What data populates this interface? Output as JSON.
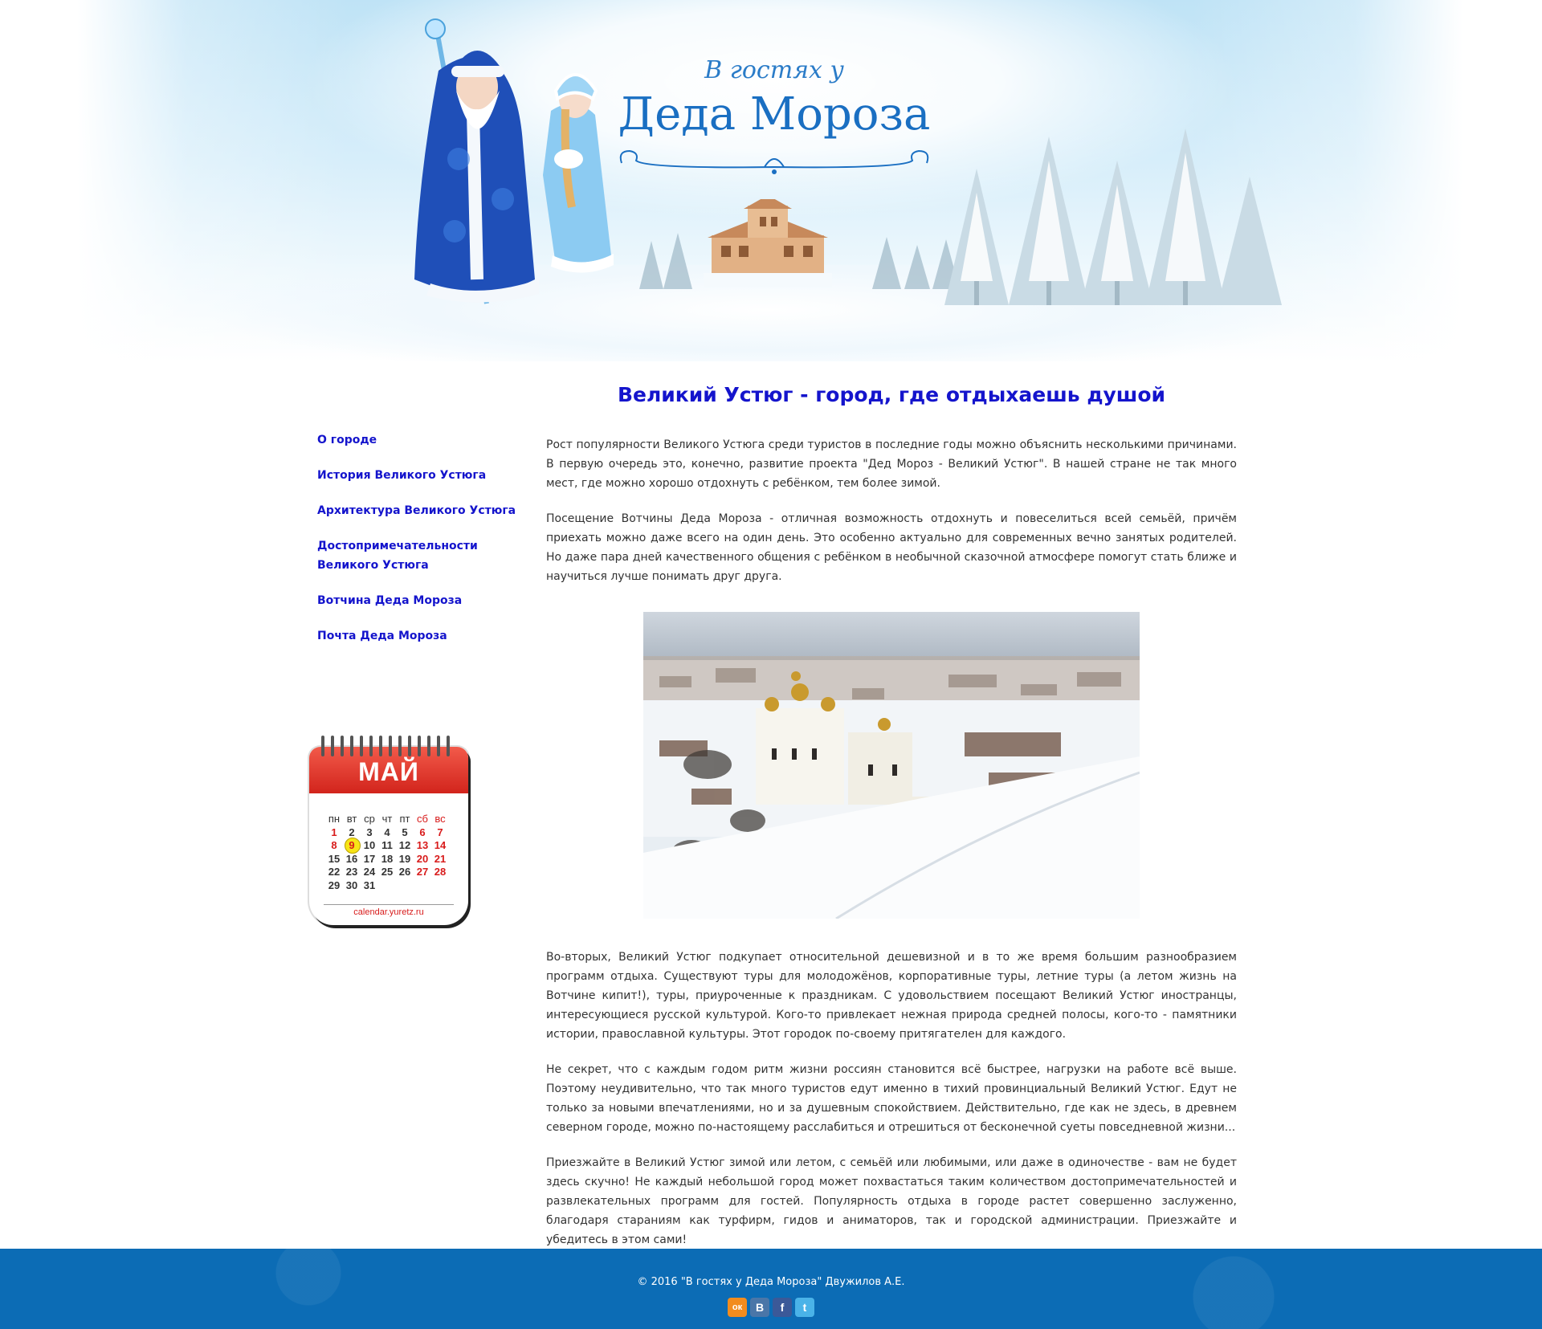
{
  "header": {
    "logo_small": "В гостях у",
    "logo_big": "Деда Мороза"
  },
  "nav": {
    "items": [
      "О городе",
      "История Великого Устюга",
      "Архитектура Великого Устюга",
      "Достопримечательности Великого Устюга",
      "Вотчина Деда Мороза",
      "Почта Деда Мороза"
    ]
  },
  "calendar": {
    "month": "МАЙ",
    "weekdays": [
      "пн",
      "вт",
      "ср",
      "чт",
      "пт",
      "сб",
      "вс"
    ],
    "weeks": [
      [
        "1",
        "2",
        "3",
        "4",
        "5",
        "6",
        "7"
      ],
      [
        "8",
        "9",
        "10",
        "11",
        "12",
        "13",
        "14"
      ],
      [
        "15",
        "16",
        "17",
        "18",
        "19",
        "20",
        "21"
      ],
      [
        "22",
        "23",
        "24",
        "25",
        "26",
        "27",
        "28"
      ],
      [
        "29",
        "30",
        "31",
        "",
        "",
        "",
        ""
      ]
    ],
    "holidays": [
      "1",
      "8",
      "9"
    ],
    "today": "9",
    "source": "calendar.yuretz.ru",
    "colors": {
      "header": "#d2241c",
      "weekend": "#d81b1b",
      "today": "#f7e417"
    }
  },
  "main": {
    "title": "Великий Устюг - город, где отдыхаешь душой",
    "paragraphs_top": [
      "Рост популярности Великого Устюга среди туристов в последние годы можно объяснить несколькими причинами. В первую очередь это, конечно, развитие проекта \"Дед Мороз - Великий Устюг\". В нашей стране не так много мест, где можно хорошо отдохнуть с ребёнком, тем более зимой.",
      "Посещение Вотчины Деда Мороза - отличная возможность отдохнуть и повеселиться всей семьёй, причём приехать можно даже всего на один день. Это особенно актуально для современных вечно занятых родителей. Но даже пара дней качественного общения с ребёнком в необычной сказочной атмосфере помогут стать ближе и научиться лучше понимать друг друга."
    ],
    "paragraphs_bottom": [
      "Во-вторых, Великий Устюг подкупает относительной дешевизной и в то же время большим разнообразием программ отдыха. Существуют туры для молодожёнов, корпоративные туры, летние туры (а летом жизнь на Вотчине кипит!), туры, приуроченные к праздникам. С удовольствием посещают Великий Устюг иностранцы, интересующиеся русской культурой. Кого-то привлекает нежная природа средней полосы, кого-то - памятники истории, православной культуры. Этот городок по-своему притягателен для каждого.",
      "Не секрет, что с каждым годом ритм жизни россиян становится всё быстрее, нагрузки на работе всё выше. Поэтому неудивительно, что так много туристов едут именно в тихий провинциальный Великий Устюг. Едут не только за новыми впечатлениями, но и за душевным спокойствием. Действительно, где как не здесь, в древнем северном городе, можно по-настоящему расслабиться и отрешиться от бесконечной суеты повседневной жизни...",
      "Приезжайте в Великий Устюг зимой или летом, с семьёй или любимыми, или даже в одиночестве - вам не будет здесь скучно! Не каждый небольшой город может похвастаться таким количеством достопримечательностей и развлекательных программ для гостей. Популярность отдыха в городе растет совершенно заслуженно, благодаря стараниям как турфирм, гидов и аниматоров, так и городской администрации. Приезжайте и убедитесь в этом сами!"
    ]
  },
  "footer": {
    "copyright": "© 2016 \"В гостях у Деда Мороза\" Двужилов А.Е.",
    "socials": [
      {
        "icon": "odnoklassniki-icon",
        "glyph": "ок",
        "color": "#f28c1e"
      },
      {
        "icon": "vkontakte-icon",
        "glyph": "В",
        "color": "#4a76a8"
      },
      {
        "icon": "facebook-icon",
        "glyph": "f",
        "color": "#3b5998"
      },
      {
        "icon": "twitter-icon",
        "glyph": "t",
        "color": "#4ab3e8"
      }
    ]
  }
}
